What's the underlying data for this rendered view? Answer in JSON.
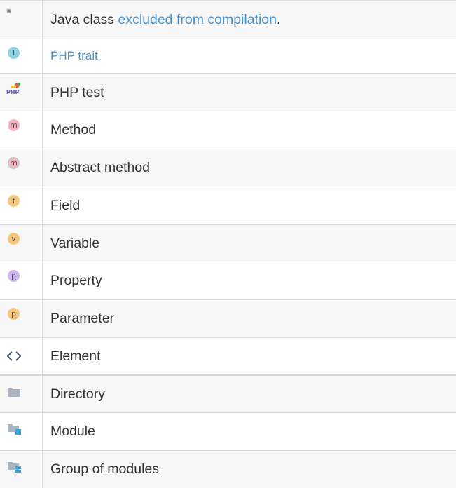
{
  "rows": [
    {
      "icon": "excluded-java-class-icon",
      "text_before": "Java class ",
      "link": "excluded from compilation",
      "text_after": "."
    },
    {
      "icon": "php-trait-icon",
      "glyph": "T",
      "link": "PHP trait"
    },
    {
      "icon": "php-test-icon",
      "glyph": "PHP",
      "label": "PHP test"
    },
    {
      "icon": "method-icon",
      "glyph": "m",
      "label": "Method"
    },
    {
      "icon": "abstract-method-icon",
      "glyph": "m",
      "label": "Abstract method"
    },
    {
      "icon": "field-icon",
      "glyph": "f",
      "label": "Field"
    },
    {
      "icon": "variable-icon",
      "glyph": "v",
      "label": "Variable"
    },
    {
      "icon": "property-icon",
      "glyph": "p",
      "label": "Property"
    },
    {
      "icon": "parameter-icon",
      "glyph": "p",
      "label": "Parameter"
    },
    {
      "icon": "element-icon",
      "glyph": "<>",
      "label": "Element"
    },
    {
      "icon": "directory-icon",
      "label": "Directory"
    },
    {
      "icon": "module-icon",
      "label": "Module"
    },
    {
      "icon": "group-of-modules-icon",
      "label": "Group of modules"
    }
  ],
  "colors": {
    "link": "#4a90c8",
    "method": "#f5b5c0",
    "field": "#f5c77e",
    "property": "#cdb6f0",
    "trait": "#8fd0e6",
    "folder": "#a8b4bf",
    "module_accent": "#3aa3d9"
  }
}
